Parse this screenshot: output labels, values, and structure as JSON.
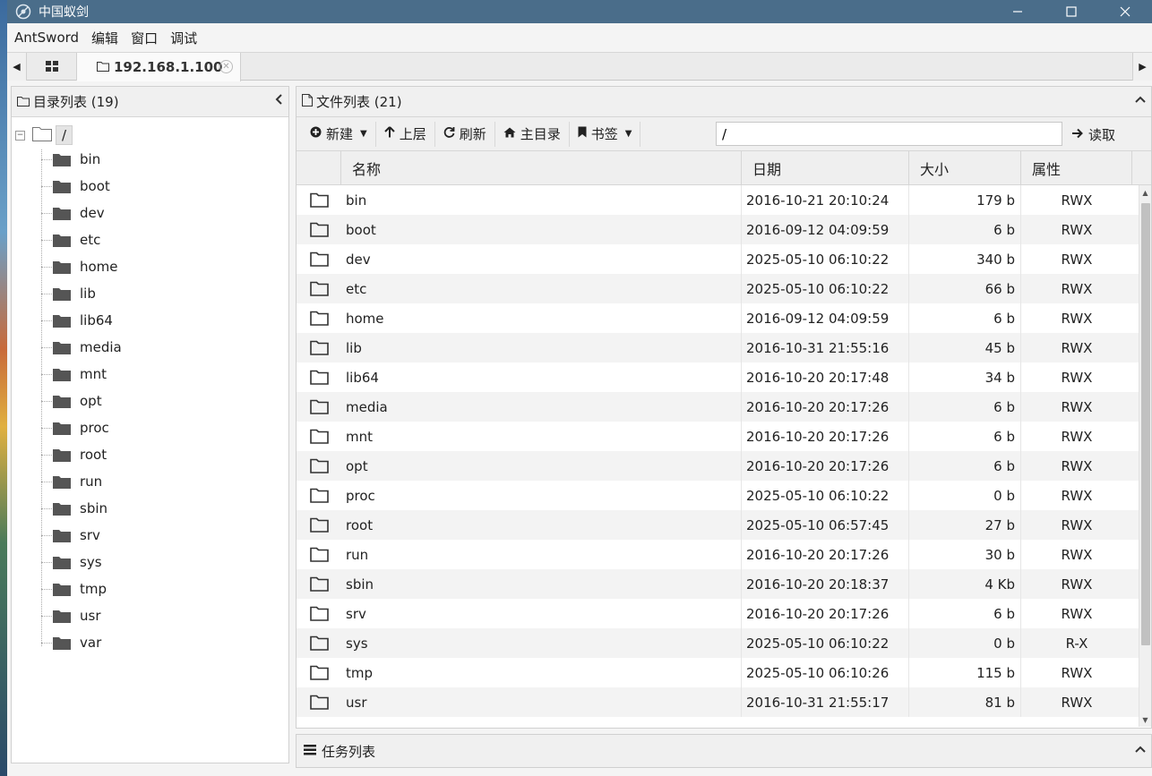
{
  "window": {
    "title": "中国蚁剑",
    "controls": {
      "minimize": "—",
      "maximize": "☐",
      "close": "✕"
    }
  },
  "menu": [
    "AntSword",
    "编辑",
    "窗口",
    "调试"
  ],
  "tabs": {
    "active_label": "192.168.1.100"
  },
  "dir_panel": {
    "title": "目录列表 (19)",
    "root": "/",
    "items": [
      "bin",
      "boot",
      "dev",
      "etc",
      "home",
      "lib",
      "lib64",
      "media",
      "mnt",
      "opt",
      "proc",
      "root",
      "run",
      "sbin",
      "srv",
      "sys",
      "tmp",
      "usr",
      "var"
    ]
  },
  "file_panel": {
    "title": "文件列表 (21)",
    "toolbar": {
      "new_label": "新建",
      "up_label": "上层",
      "refresh_label": "刷新",
      "home_label": "主目录",
      "bookmark_label": "书签",
      "path_value": "/",
      "read_label": "读取"
    },
    "columns": {
      "name": "名称",
      "date": "日期",
      "size": "大小",
      "attr": "属性"
    },
    "rows": [
      {
        "name": "bin",
        "date": "2016-10-21 20:10:24",
        "size": "179 b",
        "attr": "RWX"
      },
      {
        "name": "boot",
        "date": "2016-09-12 04:09:59",
        "size": "6 b",
        "attr": "RWX"
      },
      {
        "name": "dev",
        "date": "2025-05-10 06:10:22",
        "size": "340 b",
        "attr": "RWX"
      },
      {
        "name": "etc",
        "date": "2025-05-10 06:10:22",
        "size": "66 b",
        "attr": "RWX"
      },
      {
        "name": "home",
        "date": "2016-09-12 04:09:59",
        "size": "6 b",
        "attr": "RWX"
      },
      {
        "name": "lib",
        "date": "2016-10-31 21:55:16",
        "size": "45 b",
        "attr": "RWX"
      },
      {
        "name": "lib64",
        "date": "2016-10-20 20:17:48",
        "size": "34 b",
        "attr": "RWX"
      },
      {
        "name": "media",
        "date": "2016-10-20 20:17:26",
        "size": "6 b",
        "attr": "RWX"
      },
      {
        "name": "mnt",
        "date": "2016-10-20 20:17:26",
        "size": "6 b",
        "attr": "RWX"
      },
      {
        "name": "opt",
        "date": "2016-10-20 20:17:26",
        "size": "6 b",
        "attr": "RWX"
      },
      {
        "name": "proc",
        "date": "2025-05-10 06:10:22",
        "size": "0 b",
        "attr": "RWX"
      },
      {
        "name": "root",
        "date": "2025-05-10 06:57:45",
        "size": "27 b",
        "attr": "RWX"
      },
      {
        "name": "run",
        "date": "2016-10-20 20:17:26",
        "size": "30 b",
        "attr": "RWX"
      },
      {
        "name": "sbin",
        "date": "2016-10-20 20:18:37",
        "size": "4 Kb",
        "attr": "RWX"
      },
      {
        "name": "srv",
        "date": "2016-10-20 20:17:26",
        "size": "6 b",
        "attr": "RWX"
      },
      {
        "name": "sys",
        "date": "2025-05-10 06:10:22",
        "size": "0 b",
        "attr": "R-X"
      },
      {
        "name": "tmp",
        "date": "2025-05-10 06:10:26",
        "size": "115 b",
        "attr": "RWX"
      },
      {
        "name": "usr",
        "date": "2016-10-31 21:55:17",
        "size": "81 b",
        "attr": "RWX"
      }
    ]
  },
  "task_panel": {
    "title": "任务列表"
  },
  "icons": {
    "app": "antsword-logo-icon",
    "folder": "folder-icon",
    "file": "file-icon",
    "tasks": "list-icon"
  }
}
